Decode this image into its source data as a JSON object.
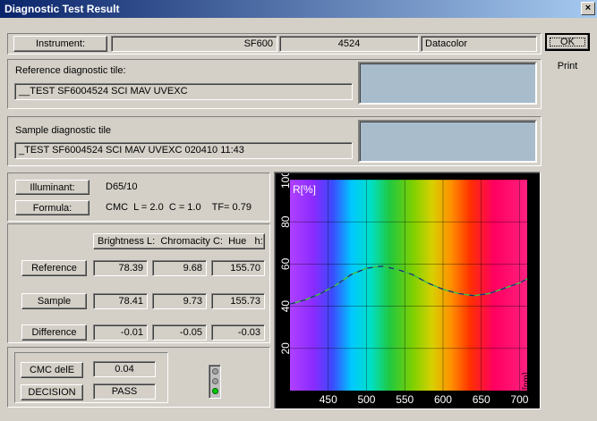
{
  "window": {
    "title": "Diagnostic Test Result",
    "close": "×"
  },
  "actions": {
    "ok": "OK",
    "print": "Print"
  },
  "instrument": {
    "label": "Instrument:",
    "value1": "",
    "model": "SF600",
    "serial": "4524",
    "maker": "Datacolor"
  },
  "reference_tile": {
    "label": "Reference diagnostic tile:",
    "name": "__TEST SF6004524 SCI MAV UVEXC",
    "swatch_color": "#a8bccc"
  },
  "sample_tile": {
    "label": "Sample diagnostic tile",
    "name": "_TEST SF6004524 SCI MAV UVEXC  020410 11:43",
    "swatch_color": "#a8bccc"
  },
  "illuminant": {
    "label": "Illuminant:",
    "value": "D65/10"
  },
  "formula": {
    "label": "Formula:",
    "value": "CMC  L = 2.0  C = 1.0    TF= 0.79"
  },
  "table": {
    "header": "Brightness L:  Chromacity C:  Hue   h:",
    "rows": [
      {
        "label": "Reference",
        "L": "78.39",
        "C": "9.68",
        "h": "155.70"
      },
      {
        "label": "Sample",
        "L": "78.41",
        "C": "9.73",
        "h": "155.73"
      },
      {
        "label": "Difference",
        "L": "-0.01",
        "C": "-0.05",
        "h": "-0.03"
      }
    ]
  },
  "result": {
    "cmc_label": "CMC delE",
    "cmc_value": "0.04",
    "decision_label": "DECISION",
    "decision_value": "PASS",
    "light_color": "#00cc00"
  },
  "chart_data": {
    "type": "line",
    "ylabel": "R[%]",
    "xlabel": "[nm]",
    "xlim": [
      400,
      710
    ],
    "ylim": [
      0,
      100
    ],
    "x_ticks": [
      "450",
      "500",
      "550",
      "600",
      "650",
      "700"
    ],
    "y_ticks": [
      "20",
      "40",
      "60",
      "80",
      "100"
    ],
    "grid": true,
    "background": "visible spectrum",
    "series": [
      {
        "x": [
          400,
          420,
          440,
          460,
          480,
          500,
          520,
          540,
          560,
          580,
          600,
          620,
          640,
          660,
          680,
          700,
          710
        ],
        "values": [
          41,
          43,
          46,
          50,
          55,
          58,
          59,
          57.5,
          55,
          51,
          48,
          46,
          45,
          46,
          48.5,
          51,
          53
        ]
      }
    ]
  }
}
